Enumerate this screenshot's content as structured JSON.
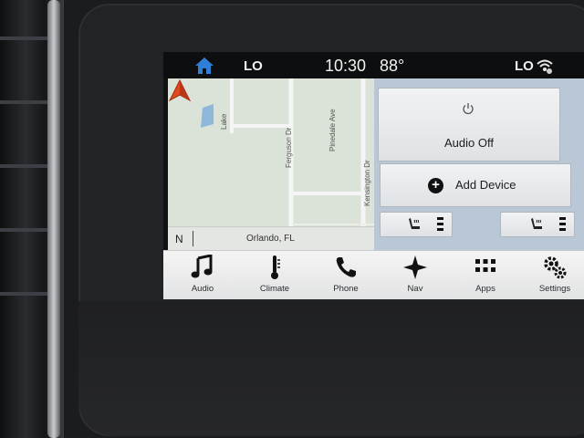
{
  "status_bar": {
    "left_indicator": "LO",
    "time": "10:30",
    "temperature": "88°",
    "right_indicator": "LO",
    "icons": [
      "home-icon",
      "wifi-icon"
    ]
  },
  "map": {
    "streets": [
      "Lake",
      "Ferguson Dr",
      "Pinedale Ave",
      "Kensington Dr"
    ],
    "compass": "N",
    "location": "Orlando, FL",
    "icons": [
      "navigation-arrow-icon"
    ]
  },
  "audio_panel": {
    "audio_off_label": "Audio Off",
    "add_device_label": "Add Device",
    "icons": [
      "power-icon",
      "plus-icon",
      "heated-seat-icon"
    ]
  },
  "menu": {
    "items": [
      {
        "label": "Audio",
        "icon": "music-note-icon"
      },
      {
        "label": "Climate",
        "icon": "thermometer-icon"
      },
      {
        "label": "Phone",
        "icon": "phone-icon"
      },
      {
        "label": "Nav",
        "icon": "compass-star-icon"
      },
      {
        "label": "Apps",
        "icon": "apps-grid-icon"
      },
      {
        "label": "Settings",
        "icon": "gears-icon"
      }
    ]
  },
  "colors": {
    "accent_blue": "#2f7fd6",
    "nav_arrow": "#e0481f",
    "panel_background": "#b9c7d6"
  }
}
